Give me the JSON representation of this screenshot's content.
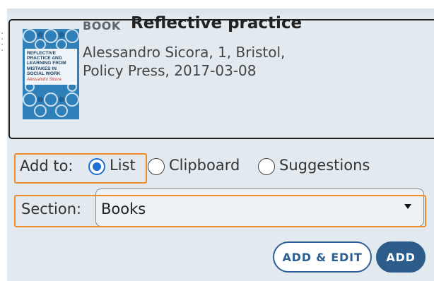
{
  "item": {
    "type": "BOOK",
    "title": "Reflective practice",
    "meta_line1": "Alessandro Sicora, 1, Bristol,",
    "meta_line2": "Policy Press, 2017-03-08",
    "cover": {
      "title": "REFLECTIVE\nPRACTICE AND\nLEARNING FROM\nMISTAKES IN\nSOCIAL WORK",
      "author": "Alessandro Sicora"
    }
  },
  "add_to": {
    "label": "Add to:",
    "options": [
      {
        "label": "List",
        "checked": true
      },
      {
        "label": "Clipboard",
        "checked": false
      },
      {
        "label": "Suggestions",
        "checked": false
      }
    ]
  },
  "section": {
    "label": "Section:",
    "selected": "Books"
  },
  "actions": {
    "add_edit": "ADD & EDIT",
    "add": "ADD"
  },
  "colors": {
    "highlight": "#ee8d2d",
    "primary": "#2b5c8a",
    "radio_checked": "#1f6fd1",
    "panel_bg": "#e2e9ef"
  }
}
